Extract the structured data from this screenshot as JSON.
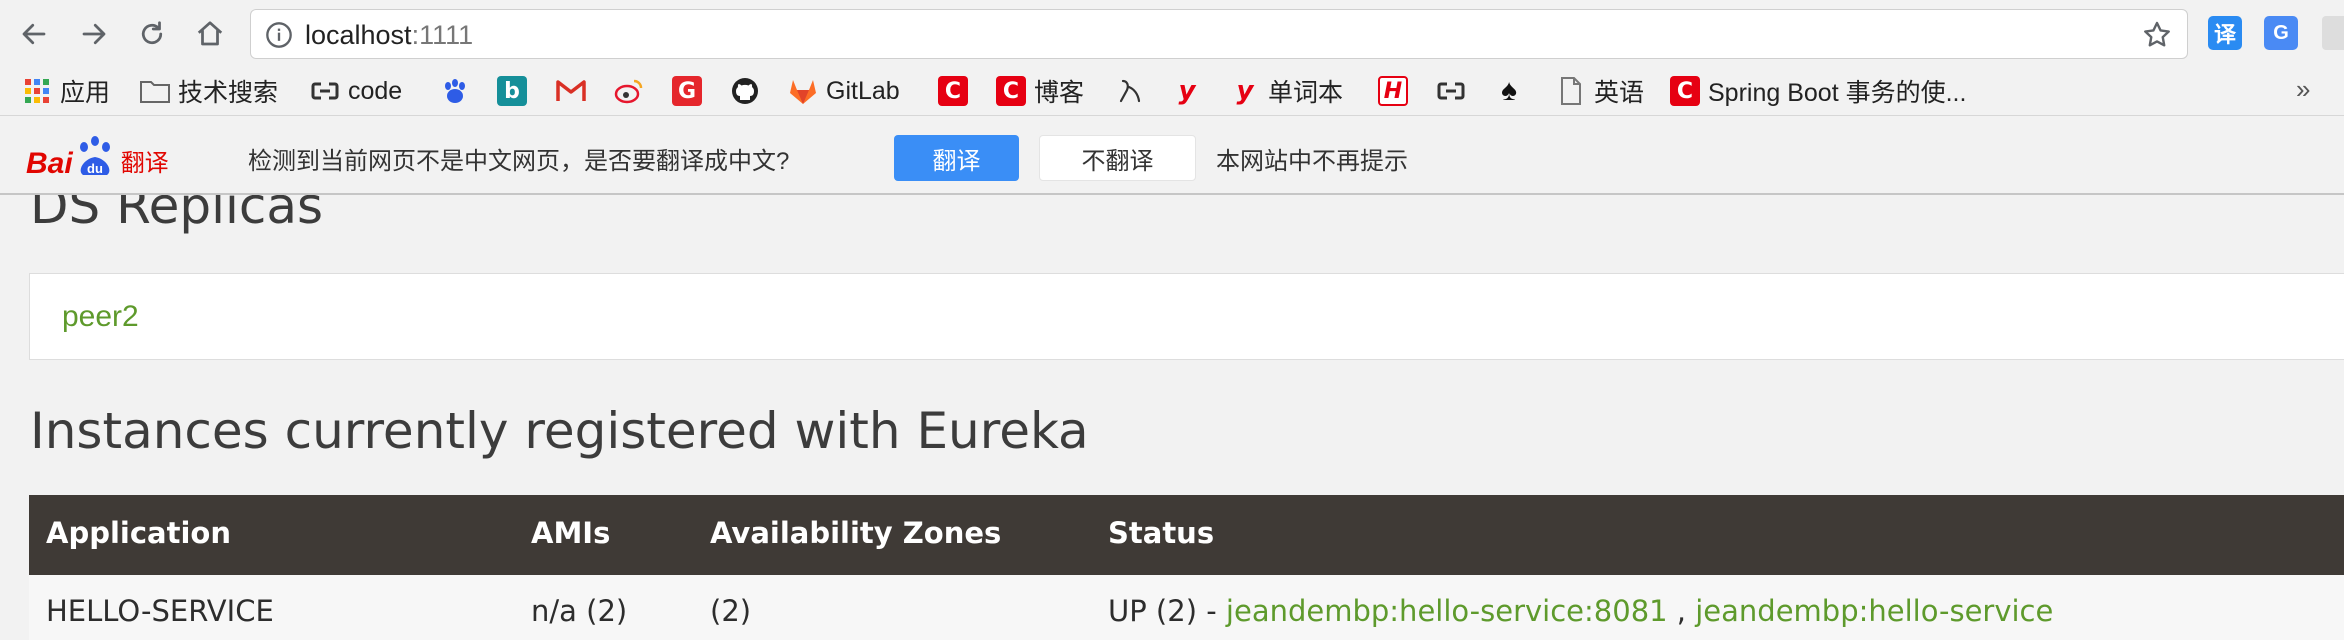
{
  "browser": {
    "url_host": "localhost",
    "url_port": ":1111",
    "extensions": [
      {
        "label": "译",
        "color": "#2a8bf2"
      },
      {
        "label": "G",
        "color": "#4a8af4"
      }
    ]
  },
  "bookmarks": {
    "items": [
      {
        "label": "应用",
        "icon": "apps-grid-icon"
      },
      {
        "label": "技术搜索",
        "icon": "folder-icon"
      },
      {
        "label": "code",
        "icon": "link-icon"
      },
      {
        "label": "",
        "icon": "baidu-paw-icon"
      },
      {
        "label": "",
        "icon": "bing-icon"
      },
      {
        "label": "",
        "icon": "gmail-icon"
      },
      {
        "label": "",
        "icon": "weibo-icon"
      },
      {
        "label": "",
        "icon": "g-red-icon"
      },
      {
        "label": "",
        "icon": "github-icon"
      },
      {
        "label": "GitLab",
        "icon": "gitlab-icon"
      },
      {
        "label": "",
        "icon": "csdn-icon"
      },
      {
        "label": "博客",
        "icon": "csdn-icon"
      },
      {
        "label": "",
        "icon": "swan-icon"
      },
      {
        "label": "",
        "icon": "youdao-icon"
      },
      {
        "label": "单词本",
        "icon": "youdao-icon"
      },
      {
        "label": "",
        "icon": "h-icon"
      },
      {
        "label": "",
        "icon": "link-icon"
      },
      {
        "label": "",
        "icon": "spade-icon"
      },
      {
        "label": "英语",
        "icon": "page-icon"
      },
      {
        "label": "Spring Boot 事务的使...",
        "icon": "csdn-icon"
      }
    ],
    "more": "»"
  },
  "translate_bar": {
    "logo_text": "Bai",
    "logo_du": "du",
    "logo_suffix": "翻译",
    "message": "检测到当前网页不是中文网页，是否要翻译成中文?",
    "translate_button": "翻译",
    "no_translate_button": "不翻译",
    "never_link": "本网站中不再提示"
  },
  "page": {
    "replicas_heading": "DS Replicas",
    "replica_link": "peer2",
    "instances_heading": "Instances currently registered with Eureka",
    "table": {
      "headers": [
        "Application",
        "AMIs",
        "Availability Zones",
        "Status"
      ],
      "rows": [
        {
          "application": "HELLO-SERVICE",
          "amis": "n/a (2)",
          "zones": "(2)",
          "status_prefix": "UP (2) - ",
          "status_link_1": "jeandembp:hello-service:8081",
          "status_sep": " , ",
          "status_link_2": "jeandembp:hello-service"
        }
      ]
    }
  },
  "colors": {
    "link_green": "#5e9a2c",
    "table_header": "#3f3a36",
    "baidu_red": "#e10601",
    "translate_blue": "#3a8ef6"
  }
}
